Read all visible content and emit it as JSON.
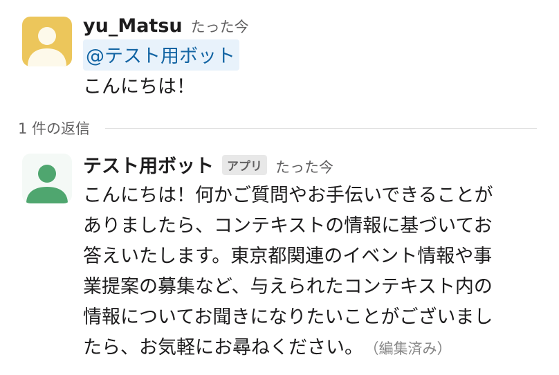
{
  "user_message": {
    "author": "yu_Matsu",
    "timestamp": "たった今",
    "mention": "@テスト用ボット",
    "text": "こんにちは！",
    "avatar_color": "#ecc65b"
  },
  "thread": {
    "reply_count_label": "1 件の返信"
  },
  "bot_message": {
    "author": "テスト用ボット",
    "badge": "アプリ",
    "timestamp": "たった今",
    "lines": [
      "こんにちは！何かご質問やお手伝いできることが",
      "ありましたら、コンテキストの情報に基づいてお",
      "答えいたします。東京都関連のイベント情報や事",
      "業提案の募集など、与えられたコンテキスト内の",
      "情報についてお聞きになりたいことがございまし",
      "たら、お気軽にお尋ねください。"
    ],
    "edited_label": "（編集済み）",
    "avatar_color": "#4fa66f"
  }
}
